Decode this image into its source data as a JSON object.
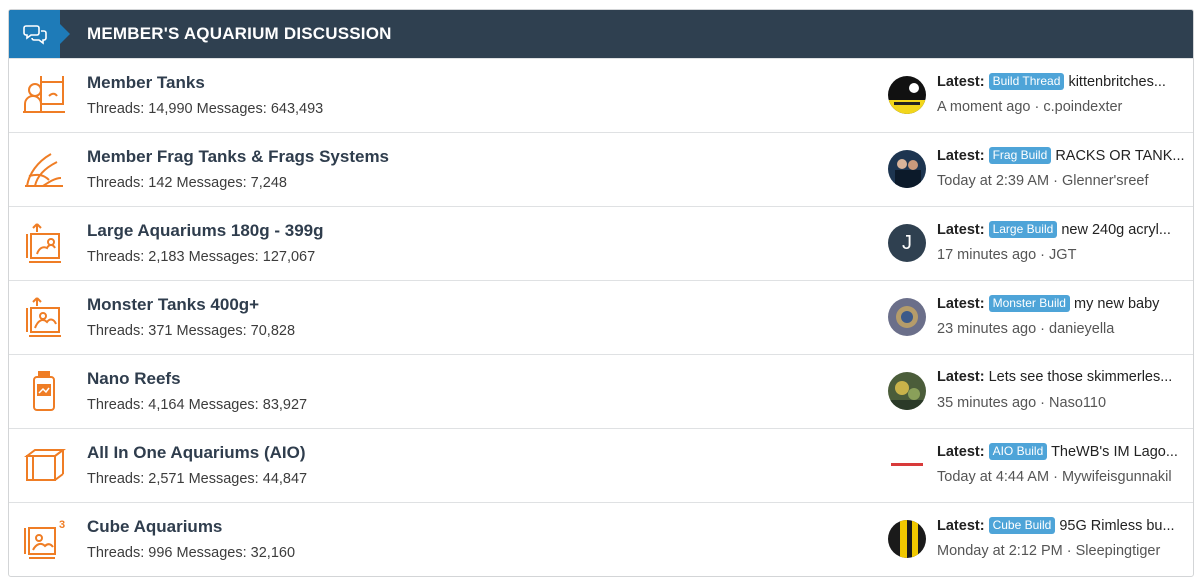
{
  "header": {
    "title": "MEMBER'S AQUARIUM DISCUSSION",
    "icon": "chat-bubbles-icon"
  },
  "colors": {
    "header_bg": "#2f4050",
    "header_icon_bg": "#1e7bb8",
    "forum_icon": "#ef7d25",
    "prefix_bg": "#4ea4d8"
  },
  "latest_label": "Latest:",
  "forums": [
    {
      "name": "Member Tanks",
      "threads_label": "Threads:",
      "threads": "14,990",
      "messages_label": "Messages:",
      "messages": "643,493",
      "icon": "person-at-tank-icon",
      "prefix": "Build Thread",
      "thread_title": "kittenbritches...",
      "time": "A moment ago",
      "user": "c.poindexter"
    },
    {
      "name": "Member Frag Tanks & Frags Systems",
      "threads_label": "Threads:",
      "threads": "142",
      "messages_label": "Messages:",
      "messages": "7,248",
      "icon": "frag-coral-icon",
      "prefix": "Frag Build",
      "thread_title": "RACKS OR TANK...",
      "time": "Today at 2:39 AM",
      "user": "Glenner'sreef"
    },
    {
      "name": "Large Aquariums 180g - 399g",
      "threads_label": "Threads:",
      "threads": "2,183",
      "messages_label": "Messages:",
      "messages": "127,067",
      "icon": "large-tank-icon",
      "prefix": "Large Build",
      "thread_title": "new 240g acryl...",
      "time": "17 minutes ago",
      "user": "JGT",
      "avatar_letter": "J"
    },
    {
      "name": "Monster Tanks 400g+",
      "threads_label": "Threads:",
      "threads": "371",
      "messages_label": "Messages:",
      "messages": "70,828",
      "icon": "monster-tank-icon",
      "prefix": "Monster Build",
      "thread_title": "my new baby",
      "time": "23 minutes ago",
      "user": "danieyella"
    },
    {
      "name": "Nano Reefs",
      "threads_label": "Threads:",
      "threads": "4,164",
      "messages_label": "Messages:",
      "messages": "83,927",
      "icon": "nano-jar-icon",
      "prefix": "",
      "thread_title": "Lets see those skimmerles...",
      "time": "35 minutes ago",
      "user": "Naso110"
    },
    {
      "name": "All In One Aquariums (AIO)",
      "threads_label": "Threads:",
      "threads": "2,571",
      "messages_label": "Messages:",
      "messages": "44,847",
      "icon": "aio-tank-icon",
      "prefix": "AIO Build",
      "thread_title": "TheWB's IM Lago...",
      "time": "Today at 4:44 AM",
      "user": "Mywifeisgunnakil"
    },
    {
      "name": "Cube Aquariums",
      "threads_label": "Threads:",
      "threads": "996",
      "messages_label": "Messages:",
      "messages": "32,160",
      "icon": "cube-tank-icon",
      "prefix": "Cube Build",
      "thread_title": "95G Rimless bu...",
      "time": "Monday at 2:12 PM",
      "user": "Sleepingtiger"
    }
  ]
}
